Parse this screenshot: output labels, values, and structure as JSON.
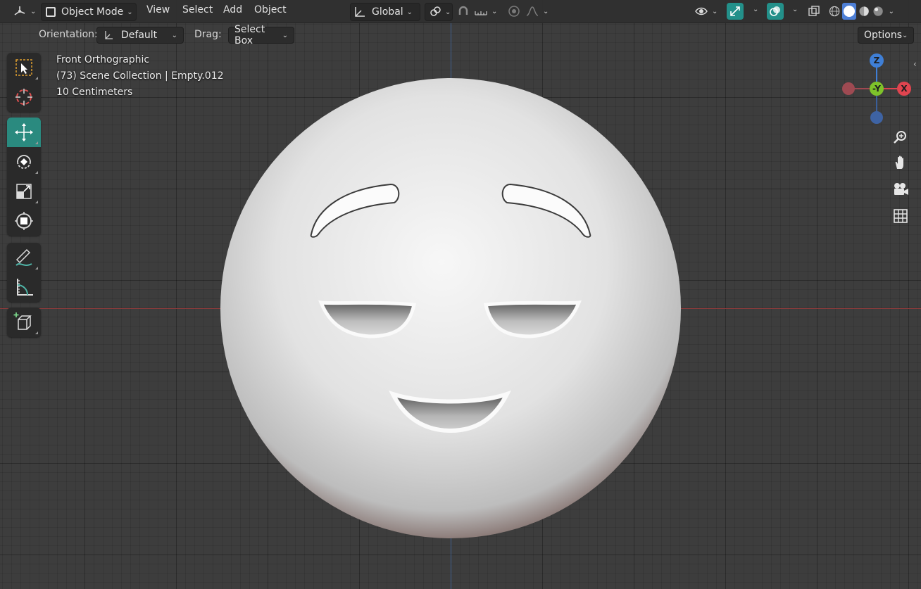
{
  "header": {
    "mode_label": "Object Mode",
    "menus": [
      "View",
      "Select",
      "Add",
      "Object"
    ],
    "transform_orientation": "Global"
  },
  "tool_settings": {
    "orientation_label": "Orientation:",
    "orientation_value": "Default",
    "drag_label": "Drag:",
    "drag_value": "Select Box",
    "options_label": "Options"
  },
  "viewport_info": {
    "view_name": "Front Orthographic",
    "collection_line": "(73) Scene Collection | Empty.012",
    "scale_line": "10 Centimeters"
  },
  "gizmo": {
    "z_label": "Z",
    "y_label": "-Y",
    "x_label": "X"
  },
  "toolbar_tools": [
    "select-box",
    "cursor",
    "move",
    "rotate",
    "scale",
    "transform",
    "annotate",
    "measure",
    "add-cube"
  ],
  "colors": {
    "accent": "#2a8a7f",
    "x_axis": "#e0444f",
    "y_axis": "#7ec22a",
    "z_axis": "#3f7fd6"
  }
}
